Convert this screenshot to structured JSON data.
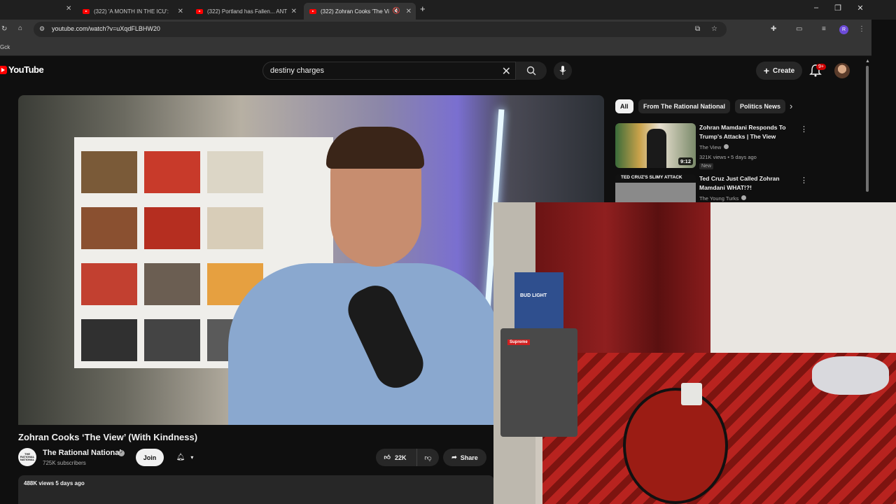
{
  "browser": {
    "tabs": [
      {
        "label": "(322) 'A MONTH IN THE ICU':",
        "active": false
      },
      {
        "label": "(322) Portland has Fallen... ANT",
        "active": false
      },
      {
        "label": "(322) Zohran Cooks 'The Vi",
        "active": true
      }
    ],
    "new_tab": "+",
    "url": "youtube.com/watch?v=uXqdFLBHW20",
    "bookmark": "Gck",
    "window_controls": {
      "minimize": "–",
      "maximize": "❐",
      "close": "✕"
    }
  },
  "youtube": {
    "logo_text": "YouTube",
    "search_value": "destiny charges",
    "create_label": "Create",
    "notification_badge": "9+",
    "brand_color": "#ff0000"
  },
  "video": {
    "title": "Zohran Cooks ‘The View’ (With Kindness)",
    "channel_name": "The Rational National",
    "channel_avatar_text": "THE RATIONAL NATIONAL",
    "subscribers": "725K subscribers",
    "join_label": "Join",
    "like_count": "22K",
    "share_label": "Share",
    "views_line": "488K views  5 days ago"
  },
  "filters": {
    "chips": [
      "All",
      "From The Rational National",
      "Politics News"
    ]
  },
  "recommendations": [
    {
      "title": "Zohran Mamdani Responds To Trump's Attacks | The View",
      "channel": "The View",
      "meta": "321K views • 5 days ago",
      "badge": "New",
      "duration": "9:12"
    },
    {
      "title": "Ted Cruz Just Called Zohran Mamdani WHAT!?!",
      "channel": "The Young Turks",
      "thumb_caption": "TED CRUZ'S SLIMY ATTACK"
    }
  ],
  "webcam": {
    "box_text": "BUD LIGHT",
    "sticker_text": "Supreme"
  }
}
